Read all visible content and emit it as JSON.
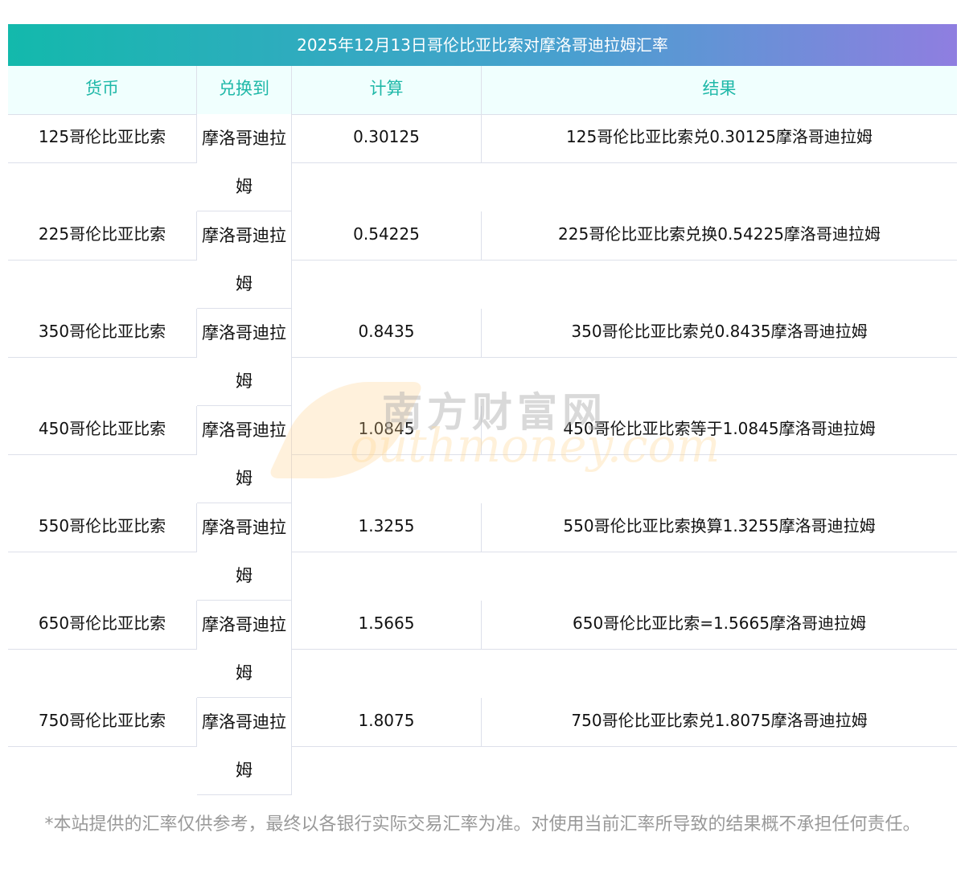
{
  "title": "2025年12月13日哥伦比亚比索对摩洛哥迪拉姆汇率",
  "headers": [
    "货币",
    "兑换到",
    "计算",
    "结果"
  ],
  "rows": [
    {
      "currency": "125哥伦比亚比索",
      "target": "摩洛哥迪拉姆",
      "calc": "0.30125",
      "result": "125哥伦比亚比索兑0.30125摩洛哥迪拉姆"
    },
    {
      "currency": "225哥伦比亚比索",
      "target": "摩洛哥迪拉姆",
      "calc": "0.54225",
      "result": "225哥伦比亚比索兑换0.54225摩洛哥迪拉姆"
    },
    {
      "currency": "350哥伦比亚比索",
      "target": "摩洛哥迪拉姆",
      "calc": "0.8435",
      "result": "350哥伦比亚比索兑0.8435摩洛哥迪拉姆"
    },
    {
      "currency": "450哥伦比亚比索",
      "target": "摩洛哥迪拉姆",
      "calc": "1.0845",
      "result": "450哥伦比亚比索等于1.0845摩洛哥迪拉姆"
    },
    {
      "currency": "550哥伦比亚比索",
      "target": "摩洛哥迪拉姆",
      "calc": "1.3255",
      "result": "550哥伦比亚比索换算1.3255摩洛哥迪拉姆"
    },
    {
      "currency": "650哥伦比亚比索",
      "target": "摩洛哥迪拉姆",
      "calc": "1.5665",
      "result": "650哥伦比亚比索=1.5665摩洛哥迪拉姆"
    },
    {
      "currency": "750哥伦比亚比索",
      "target": "摩洛哥迪拉姆",
      "calc": "1.8075",
      "result": "750哥伦比亚比索兑1.8075摩洛哥迪拉姆"
    }
  ],
  "watermark": {
    "cn": "南方财富网",
    "en": "southmoney.com"
  },
  "footer": "*本站提供的汇率仅供参考，最终以各银行实际交易汇率为准。对使用当前汇率所导致的结果概不承担任何责任。"
}
